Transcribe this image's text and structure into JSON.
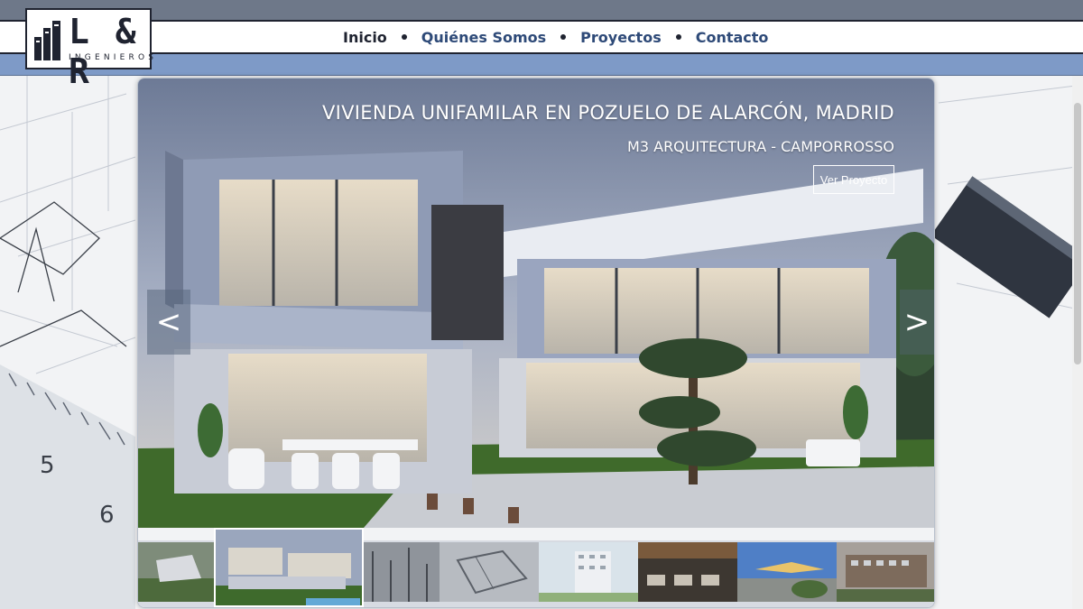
{
  "brand": {
    "logo_text": "L & R",
    "logo_subtext": "INGENIEROS"
  },
  "nav": {
    "items": [
      {
        "label": "Inicio",
        "active": true
      },
      {
        "label": "Quiénes Somos",
        "active": false
      },
      {
        "label": "Proyectos",
        "active": false
      },
      {
        "label": "Contacto",
        "active": false
      }
    ]
  },
  "slider": {
    "title": "VIVIENDA UNIFAMILAR EN POZUELO DE ALARCÓN, MADRID",
    "subtitle": "M3 ARQUITECTURA - CAMPORROSSO",
    "button_label": "Ver Proyecto",
    "prev_symbol": "<",
    "next_symbol": ">",
    "thumbnail_count": 8,
    "selected_thumbnail": 2
  },
  "colors": {
    "header_band": "#6e7889",
    "accent_band": "#7e9ac7",
    "nav_text": "#2e4a78",
    "nav_active": "#1f2330"
  }
}
